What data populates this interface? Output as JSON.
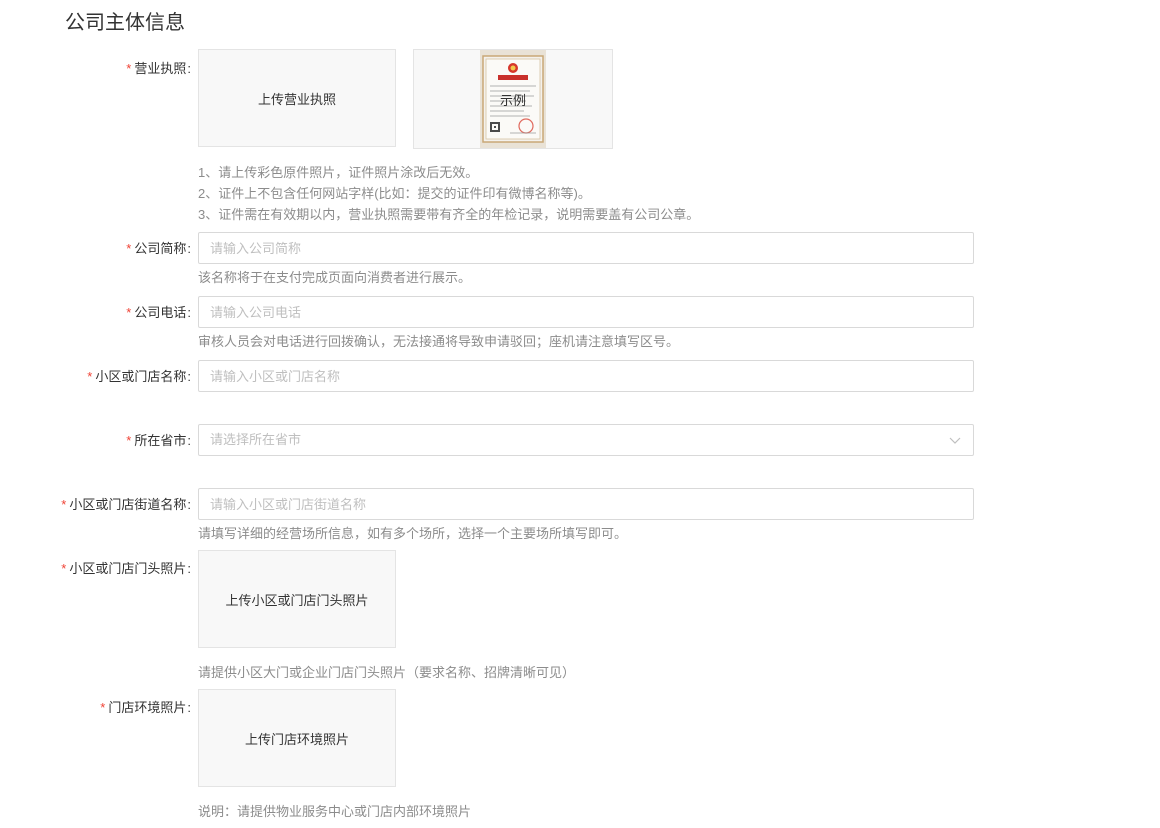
{
  "section": {
    "title": "公司主体信息"
  },
  "license": {
    "label": "营业执照",
    "upload_text": "上传营业执照",
    "sample_text": "示例",
    "tips": [
      "1、请上传彩色原件照片，证件照片涂改后无效。",
      "2、证件上不包含任何网站字样(比如：提交的证件印有微博名称等)。",
      "3、证件需在有效期以内，营业执照需要带有齐全的年检记录，说明需要盖有公司公章。"
    ]
  },
  "company_short_name": {
    "label": "公司简称",
    "placeholder": "请输入公司简称",
    "value": "",
    "hint": "该名称将于在支付完成页面向消费者进行展示。"
  },
  "company_phone": {
    "label": "公司电话",
    "placeholder": "请输入公司电话",
    "value": "",
    "hint": "审核人员会对电话进行回拨确认，无法接通将导致申请驳回；座机请注意填写区号。"
  },
  "store_name": {
    "label": "小区或门店名称",
    "placeholder": "请输入小区或门店名称",
    "value": ""
  },
  "province_city": {
    "label": "所在省市",
    "placeholder": "请选择所在省市"
  },
  "street_name": {
    "label": "小区或门店街道名称",
    "placeholder": "请输入小区或门店街道名称",
    "value": "",
    "hint": "请填写详细的经营场所信息，如有多个场所，选择一个主要场所填写即可。"
  },
  "storefront_photo": {
    "label": "小区或门店门头照片",
    "upload_text": "上传小区或门店门头照片",
    "hint": "请提供小区大门或企业门店门头照片（要求名称、招牌清晰可见）"
  },
  "environment_photo": {
    "label": "门店环境照片",
    "upload_text": "上传门店环境照片",
    "hint": "说明：请提供物业服务中心或门店内部环境照片"
  },
  "required_mark": "*",
  "colors": {
    "required": "#f04134",
    "hint": "#8c8c8c",
    "border": "#d9d9d9",
    "placeholder": "#bfbfbf"
  },
  "icons": {
    "select_arrow": "chevron-down-icon",
    "sample_image": "business-license-thumbnail"
  }
}
